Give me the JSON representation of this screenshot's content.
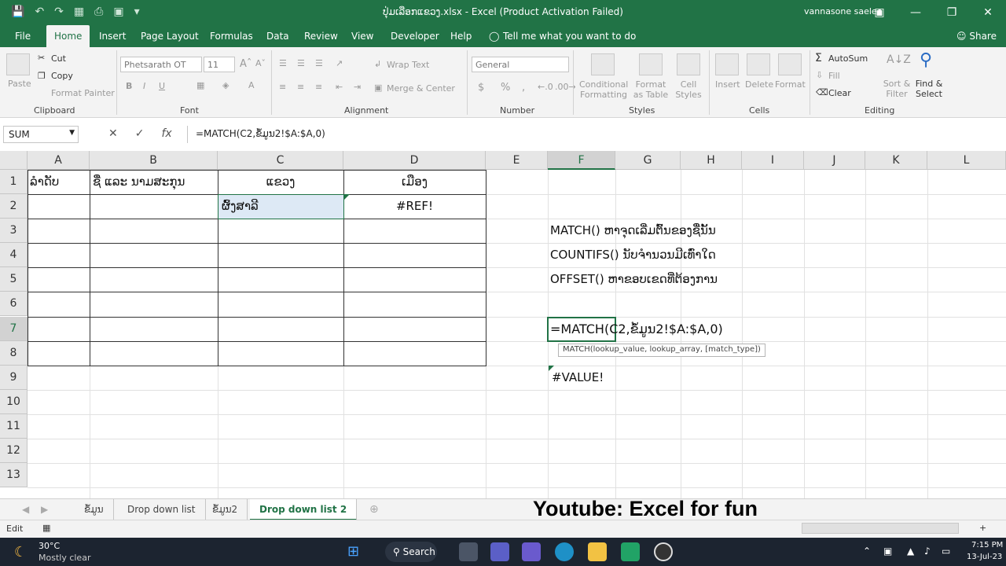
{
  "titlebar": {
    "title": "ປຸ່ມເລືອກແຂວງ.xlsx  -  Excel (Product Activation Failed)",
    "user": "vannasone saelee"
  },
  "tabs": [
    "File",
    "Home",
    "Insert",
    "Page Layout",
    "Formulas",
    "Data",
    "Review",
    "View",
    "Developer",
    "Help"
  ],
  "tell_me": "Tell me what you want to do",
  "share": "Share",
  "ribbon": {
    "paste": "Paste",
    "cut": "Cut",
    "copy": "Copy",
    "format_painter": "Format Painter",
    "clipboard": "Clipboard",
    "font_name": "Phetsarath OT",
    "font_size": "11",
    "font": "Font",
    "wrap_text": "Wrap Text",
    "merge_center": "Merge & Center",
    "alignment": "Alignment",
    "number_format": "General",
    "number": "Number",
    "conditional_formatting": "Conditional Formatting",
    "format_as_table": "Format as Table",
    "cell_styles": "Cell Styles",
    "styles": "Styles",
    "insert": "Insert",
    "delete": "Delete",
    "format": "Format",
    "cells": "Cells",
    "autosum": "AutoSum",
    "fill": "Fill",
    "clear": "Clear",
    "sort_filter": "Sort & Filter",
    "find_select": "Find & Select",
    "editing": "Editing"
  },
  "formula_bar": {
    "name_box": "SUM",
    "formula": "=MATCH(C2,ຂໍ້ມູນ2!$A:$A,0)"
  },
  "columns": [
    "A",
    "B",
    "C",
    "D",
    "E",
    "F",
    "G",
    "H",
    "I",
    "J",
    "K",
    "L"
  ],
  "rows": [
    "1",
    "2",
    "3",
    "4",
    "5",
    "6",
    "7",
    "8",
    "9",
    "10",
    "11",
    "12",
    "13"
  ],
  "cells": {
    "a1": "ລຳດັບ",
    "b1": "ຊື່ ແລະ ນາມສະກຸນ",
    "c1": "ແຂວງ",
    "d1": "ເມືອງ",
    "c2": "ຜົ້ງສາລີ",
    "d2": "#REF!",
    "f3": "MATCH() ຫາຈຸດເລີ່ມຕົ້ນຂອງຊື່ນັ້ນ",
    "f4": "COUNTIFS() ນັບຈຳນວນມີເທົ່າໃດ",
    "f5": "OFFSET() ຫາຂອບເຂດທີ່ຕ້ອງການ",
    "f7": "=MATCH(C2,ຂໍ້ມູນ2!$A:$A,0)",
    "f9": "#VALUE!"
  },
  "tooltip": "MATCH(lookup_value, lookup_array, [match_type])",
  "sheets": [
    "ຂໍ້ມູນ",
    "Drop down list",
    "ຂໍ້ມູນ2",
    "Drop down list 2"
  ],
  "watermark": "Youtube: Excel for fun",
  "status": {
    "mode": "Edit"
  },
  "taskbar": {
    "weather_temp": "30°C",
    "weather_desc": "Mostly clear",
    "search": "Search",
    "time": "7:15 PM",
    "date": "13-Jul-23"
  }
}
